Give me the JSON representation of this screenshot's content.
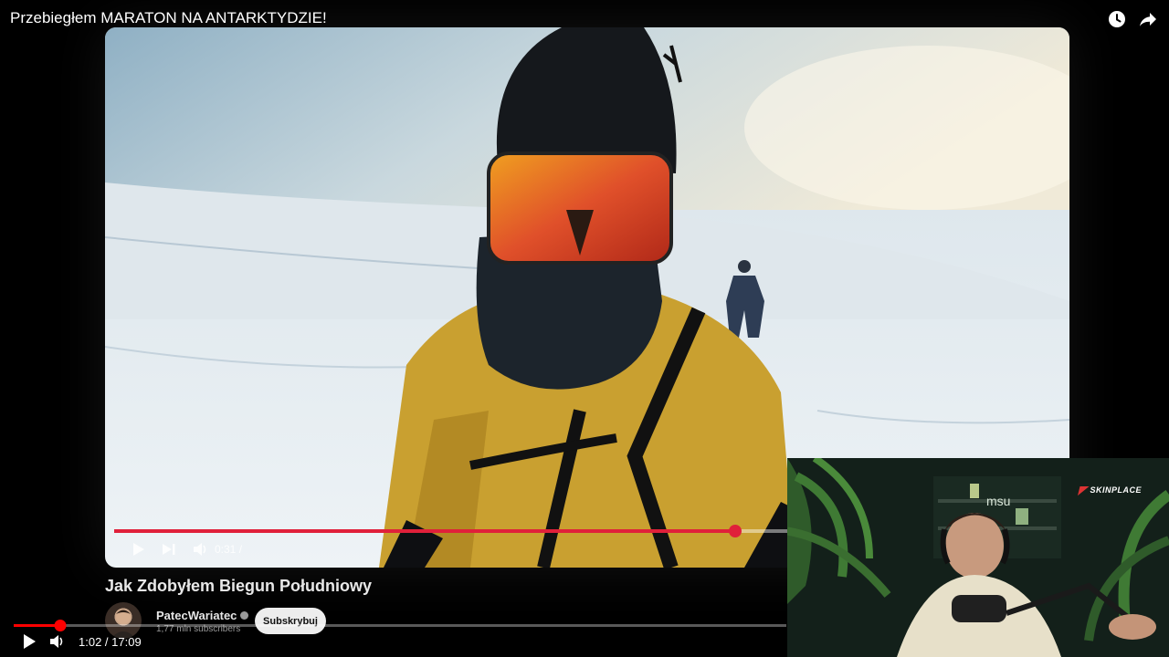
{
  "top_bar": {
    "title": "Przebiegłem MARATON NA ANTARKTYDZIE!",
    "icons": [
      "clock-icon",
      "share-icon"
    ]
  },
  "inner_player": {
    "progress": 0.65,
    "current_time": "0:31 /",
    "accent_color": "#e0203a"
  },
  "video": {
    "heading": "Jak Zdobyłem Biegun Południowy"
  },
  "channel": {
    "name": "PatecWariatec",
    "subscribers": "1,77 mln subscribers",
    "subscribe_label": "Subskrybuj"
  },
  "outer_player": {
    "progress": 0.06,
    "time": "1:02 / 17:09",
    "accent_color": "#ff0000"
  },
  "webcam": {
    "brand": "SKINPLACE",
    "sign_text": "msu"
  }
}
